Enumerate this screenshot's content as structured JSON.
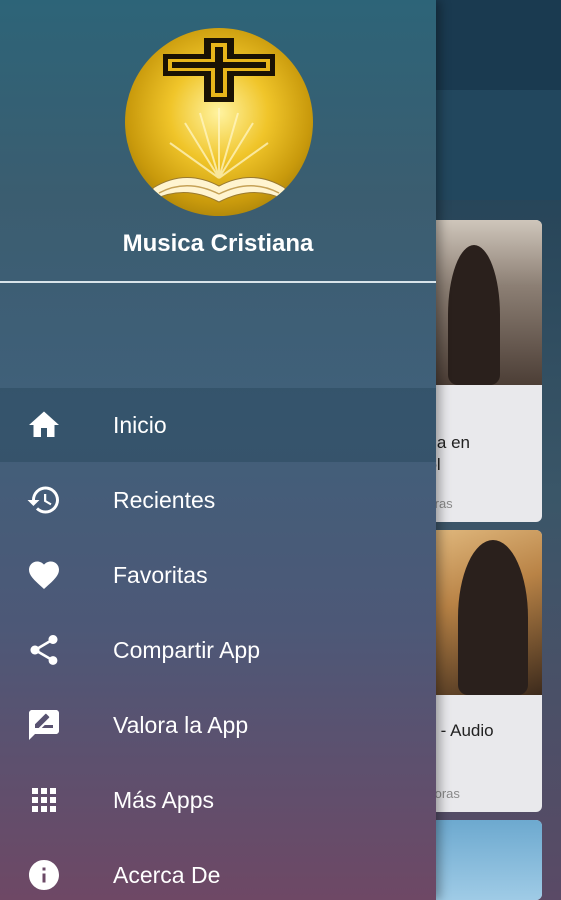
{
  "drawer": {
    "app_title": "Musica Cristiana",
    "menu": [
      {
        "label": "Inicio",
        "icon": "home-icon",
        "active": true
      },
      {
        "label": "Recientes",
        "icon": "history-icon",
        "active": false
      },
      {
        "label": "Favoritas",
        "icon": "heart-icon",
        "active": false
      },
      {
        "label": "Compartir App",
        "icon": "share-icon",
        "active": false
      },
      {
        "label": "Valora la App",
        "icon": "rate-review-icon",
        "active": false
      },
      {
        "label": "Más Apps",
        "icon": "apps-grid-icon",
        "active": false
      },
      {
        "label": "Acerca De",
        "icon": "info-icon",
        "active": false
      }
    ]
  },
  "background": {
    "cards": [
      {
        "title": "ca\nana en\nñol",
        "subtitle": "isoras"
      },
      {
        "title": "os - Audio",
        "subtitle": "nisoras"
      }
    ]
  },
  "colors": {
    "drawer_top": "#2d6478",
    "drawer_bottom": "#6e4865",
    "text": "#ffffff",
    "logo_gold": "#f0c52a"
  }
}
